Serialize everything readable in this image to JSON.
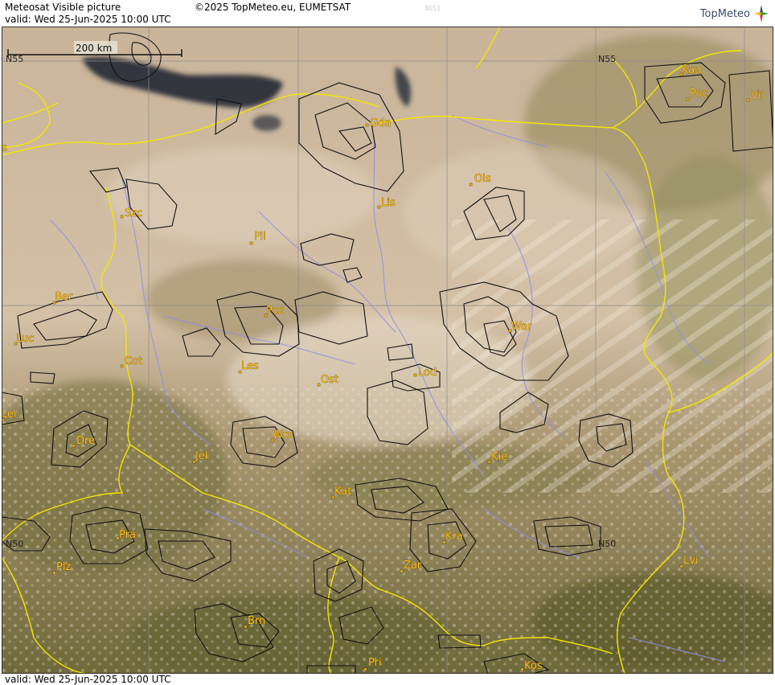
{
  "header": {
    "title": "Meteosat Visible picture",
    "copyright": "©2025 TopMeteo.eu, EUMETSAT",
    "code": "8011",
    "valid_top": "valid:  Wed  25-Jun-2025  10:00 UTC",
    "logo_text": "TopMeteo"
  },
  "footer": {
    "valid_bottom": "valid:  Wed  25-Jun-2025  10:00 UTC"
  },
  "scale": {
    "label": "200 km"
  },
  "grid_labels": {
    "n55_left": "N55",
    "n55_mid": "N55",
    "n50_left": "N50",
    "n50_mid": "N50"
  },
  "cities": [
    {
      "name": "Gda"
    },
    {
      "name": "Kau"
    },
    {
      "name": "Poc"
    },
    {
      "name": "Vil"
    },
    {
      "name": "Ols"
    },
    {
      "name": "Lis"
    },
    {
      "name": "Szc"
    },
    {
      "name": "Pil"
    },
    {
      "name": "Ber"
    },
    {
      "name": "Poz"
    },
    {
      "name": "War"
    },
    {
      "name": "Luc"
    },
    {
      "name": "Cot"
    },
    {
      "name": "Les"
    },
    {
      "name": "Ost"
    },
    {
      "name": "Lod"
    },
    {
      "name": "Lei"
    },
    {
      "name": "Wro"
    },
    {
      "name": "Dre"
    },
    {
      "name": "Jel"
    },
    {
      "name": "Kie"
    },
    {
      "name": "Kat"
    },
    {
      "name": "Pra"
    },
    {
      "name": "Kra"
    },
    {
      "name": "Plz"
    },
    {
      "name": "Zar"
    },
    {
      "name": "Lvi"
    },
    {
      "name": "Brn"
    },
    {
      "name": "Pri"
    },
    {
      "name": "Kos"
    },
    {
      "name": "s"
    }
  ],
  "colors": {
    "border": "#f2e600",
    "river": "#8e8fe6",
    "contour": "#111111",
    "city": "#ffc21a"
  }
}
